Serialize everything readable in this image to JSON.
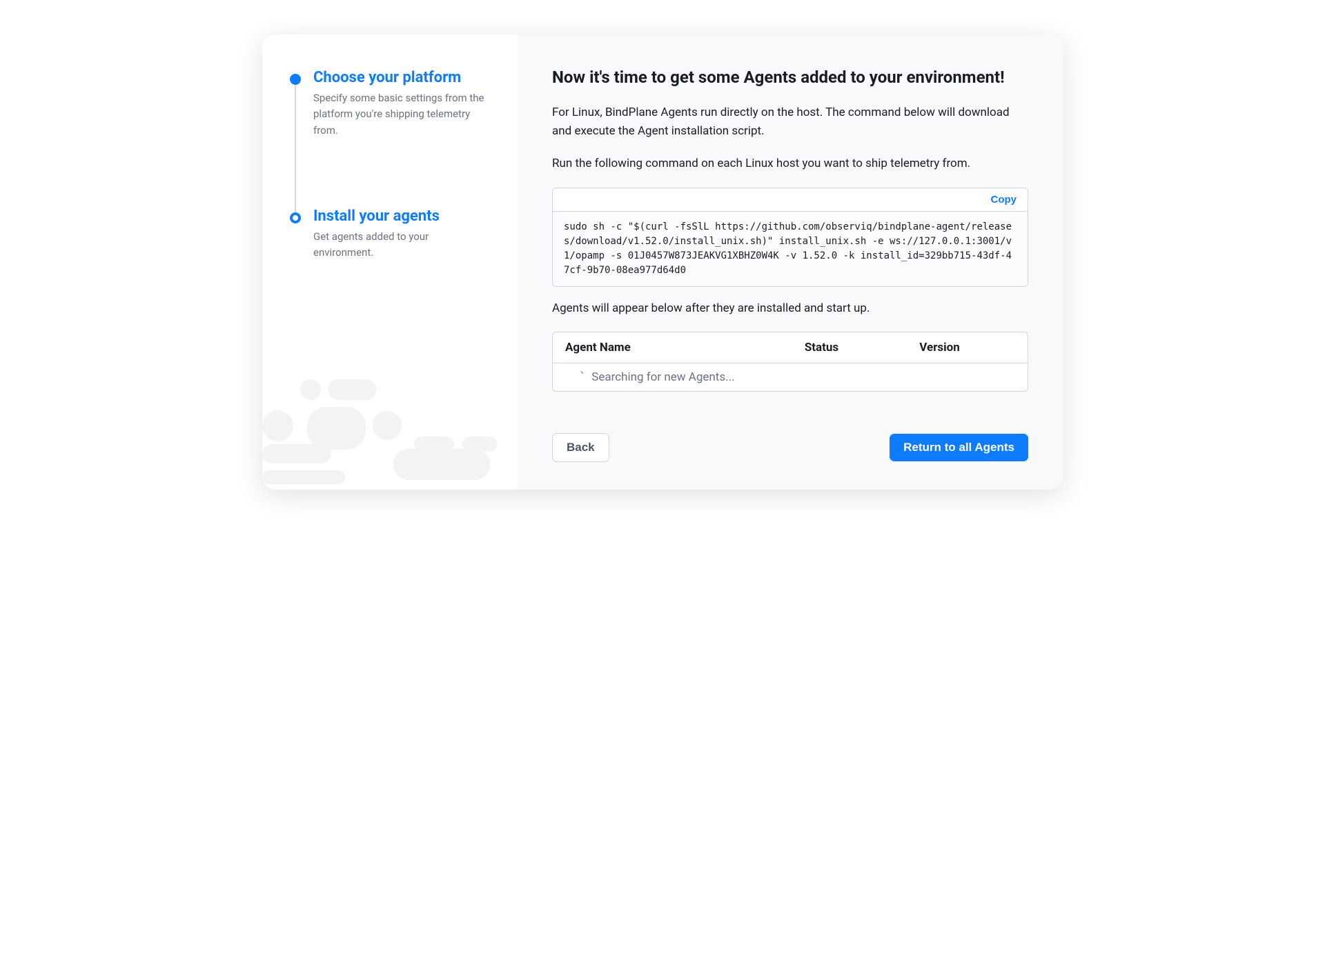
{
  "steps": [
    {
      "title": "Choose your platform",
      "description": "Specify some basic settings from the platform you're shipping telemetry from."
    },
    {
      "title": "Install your agents",
      "description": "Get agents added to your environment."
    }
  ],
  "main": {
    "heading": "Now it's time to get some Agents added to your environment!",
    "intro": "For Linux, BindPlane Agents run directly on the host. The command below will download and execute the Agent installation script.",
    "run_text": "Run the following command on each Linux host you want to ship telemetry from.",
    "after_text": "Agents will appear below after they are installed and start up.",
    "copy_label": "Copy",
    "code": "sudo sh -c \"$(curl -fsSlL https://github.com/observiq/bindplane-agent/releases/download/v1.52.0/install_unix.sh)\" install_unix.sh -e ws://127.0.0.1:3001/v1/opamp -s 01J0457W873JEAKVG1XBHZ0W4K -v 1.52.0 -k install_id=329bb715-43df-47cf-9b70-08ea977d64d0"
  },
  "table": {
    "columns": {
      "name": "Agent Name",
      "status": "Status",
      "version": "Version"
    },
    "searching_text": "Searching for new Agents..."
  },
  "footer": {
    "back_label": "Back",
    "return_label": "Return to all Agents"
  }
}
